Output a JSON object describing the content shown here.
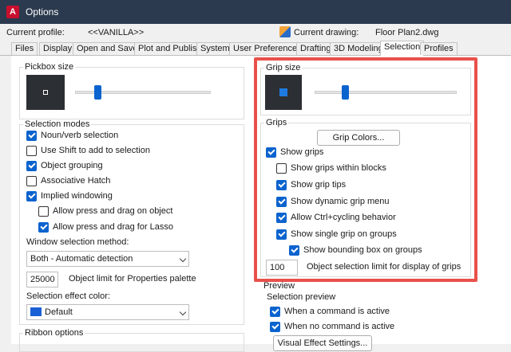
{
  "window": {
    "title": "Options",
    "app_icon_letter": "A"
  },
  "profile": {
    "label": "Current profile:",
    "value": "<<VANILLA>>",
    "drawing_label": "Current drawing:",
    "drawing_value": "Floor Plan2.dwg"
  },
  "tabs": [
    {
      "label": "Files"
    },
    {
      "label": "Display"
    },
    {
      "label": "Open and Save"
    },
    {
      "label": "Plot and Publish"
    },
    {
      "label": "System"
    },
    {
      "label": "User Preferences"
    },
    {
      "label": "Drafting"
    },
    {
      "label": "3D Modeling"
    },
    {
      "label": "Selection",
      "active": true
    },
    {
      "label": "Profiles"
    }
  ],
  "pickbox": {
    "title": "Pickbox size",
    "level": 0.3
  },
  "selection_modes": {
    "title": "Selection modes",
    "options": [
      {
        "label": "Noun/verb selection",
        "checked": true
      },
      {
        "label": "Use Shift to add to selection",
        "checked": false
      },
      {
        "label": "Object grouping",
        "checked": true
      },
      {
        "label": "Associative Hatch",
        "checked": false
      },
      {
        "label": "Implied windowing",
        "checked": true
      },
      {
        "label": "Allow press and drag on object",
        "checked": false
      },
      {
        "label": "Allow press and drag for Lasso",
        "checked": true
      }
    ],
    "window_method_label": "Window selection method:",
    "window_method_value": "Both - Automatic detection",
    "object_limit_value": "25000",
    "object_limit_label": "Object limit for Properties palette",
    "effect_color_label": "Selection effect color:",
    "effect_color_value": "Default",
    "effect_color_swatch": "#1a5fd6"
  },
  "ribbon": {
    "title": "Ribbon options"
  },
  "grip_size": {
    "title": "Grip size",
    "level": 0.45
  },
  "grips": {
    "title": "Grips",
    "colors_button": "Grip Colors...",
    "options": [
      {
        "label": "Show grips",
        "checked": true
      },
      {
        "label": "Show grips within blocks",
        "checked": false
      },
      {
        "label": "Show grip tips",
        "checked": true
      },
      {
        "label": "Show dynamic grip menu",
        "checked": true
      },
      {
        "label": "Allow Ctrl+cycling behavior",
        "checked": true
      },
      {
        "label": "Show single grip on groups",
        "checked": true
      },
      {
        "label": "Show bounding box on groups",
        "checked": true
      }
    ],
    "limit_value": "100",
    "limit_label": "Object selection limit for display of grips"
  },
  "preview": {
    "title": "Preview",
    "subtitle": "Selection preview",
    "options": [
      {
        "label": "When a command is active",
        "checked": true
      },
      {
        "label": "When no command is active",
        "checked": true
      }
    ],
    "visual_button": "Visual Effect Settings..."
  },
  "colors": {
    "accent": "#0b63ce",
    "highlight": "#e8514a",
    "titlebar": "#2b3a4e"
  }
}
